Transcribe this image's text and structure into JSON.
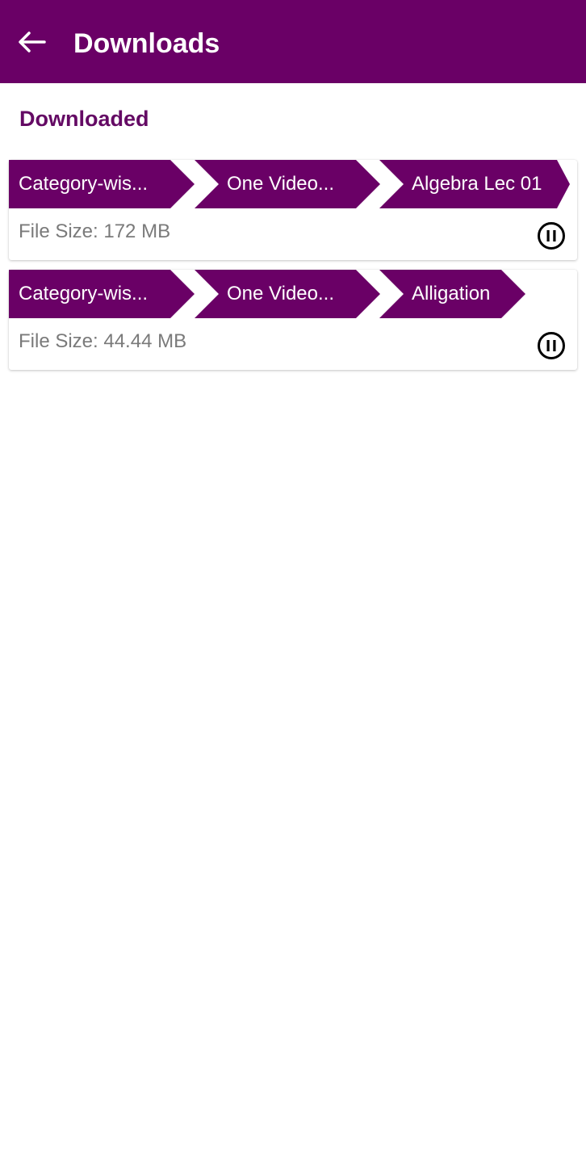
{
  "app_bar": {
    "title": "Downloads",
    "back_icon": "arrow-left-icon",
    "color": "#6a0066"
  },
  "section": {
    "title": "Downloaded"
  },
  "downloads": [
    {
      "breadcrumb": [
        "Category-wis...",
        "One Video...",
        "Algebra Lec 01"
      ],
      "file_size": "File Size: 172 MB",
      "action_icon": "pause-circle-icon"
    },
    {
      "breadcrumb": [
        "Category-wis...",
        "One Video...",
        "Alligation"
      ],
      "file_size": "File Size: 44.44 MB",
      "action_icon": "pause-circle-icon"
    }
  ]
}
